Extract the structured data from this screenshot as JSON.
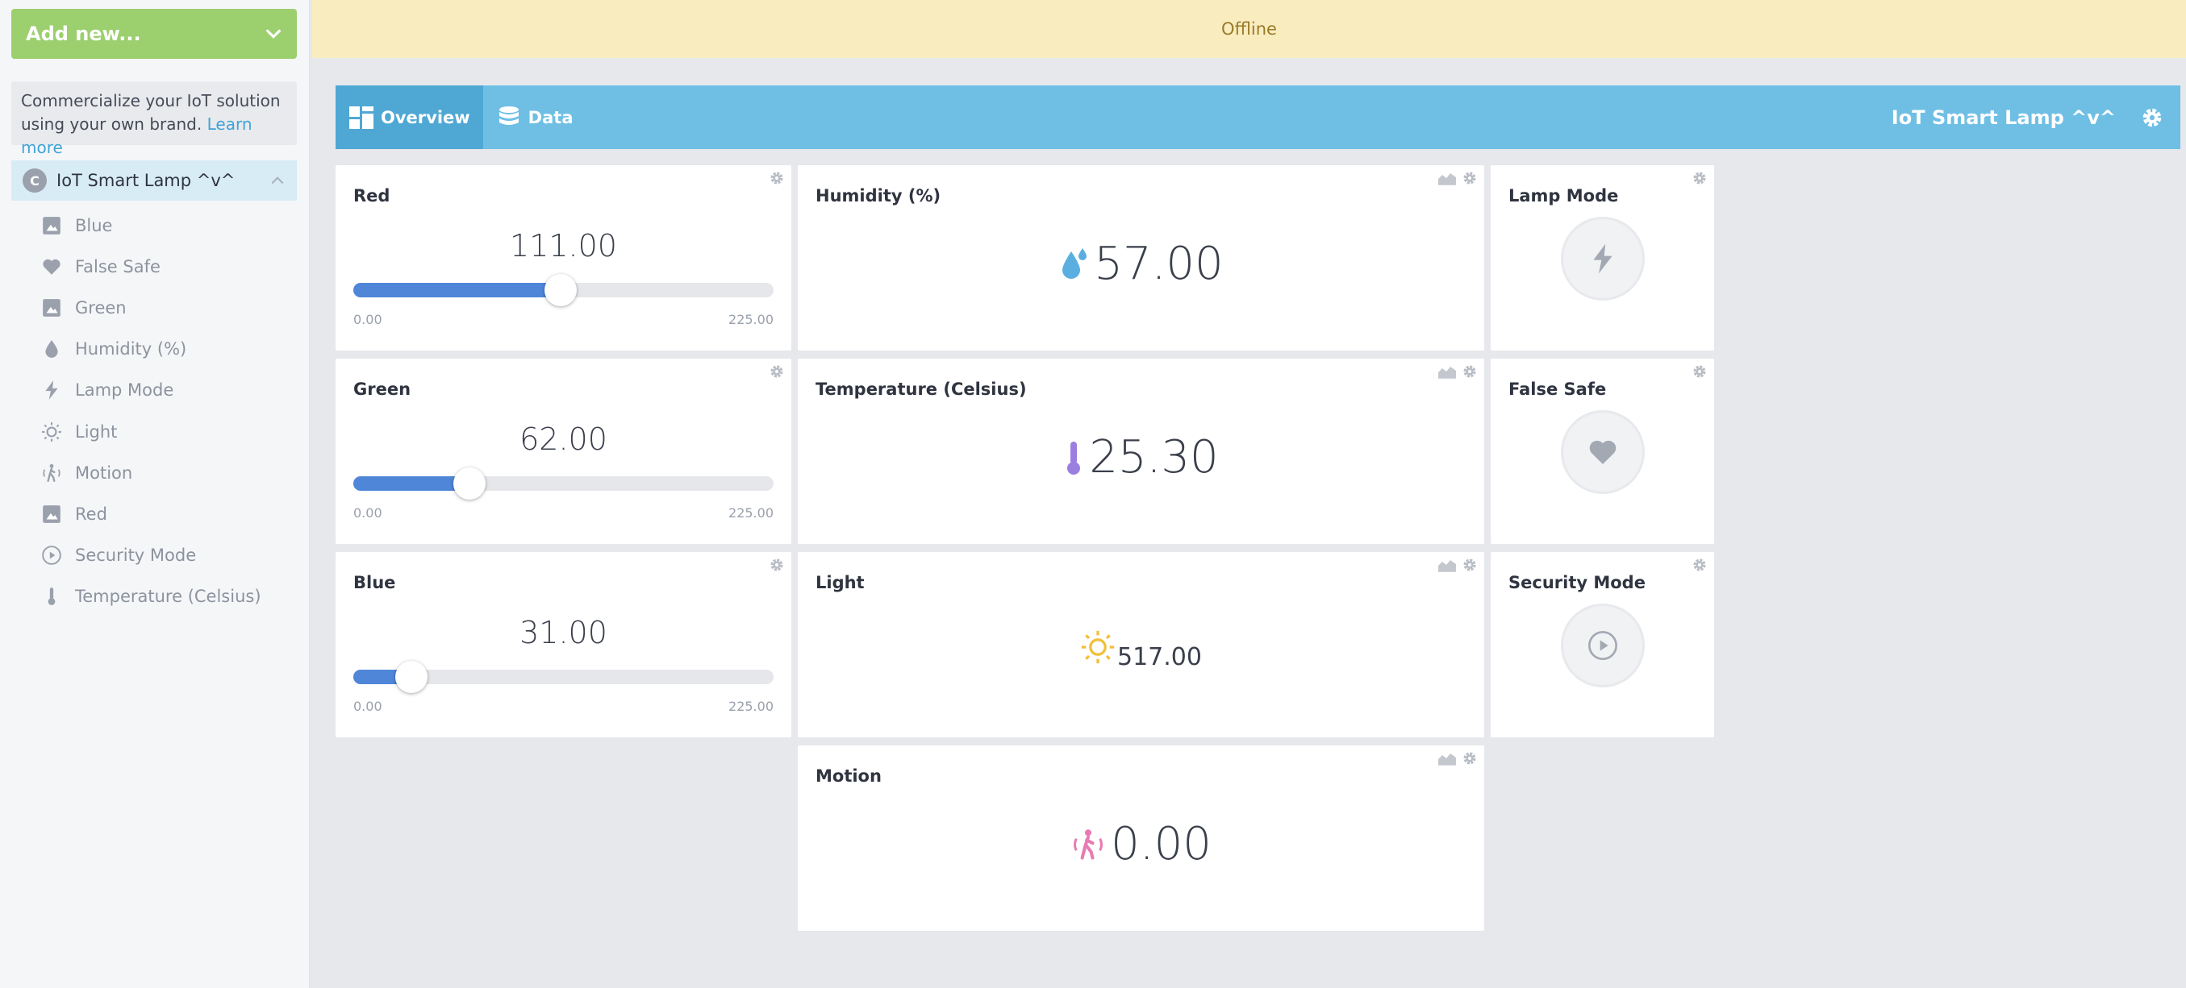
{
  "sidebar": {
    "add_new_label": "Add new...",
    "promo_text": "Commercialize your IoT solution using your own brand.",
    "promo_link": "Learn more",
    "device_name": "IoT Smart Lamp ^v^",
    "items": [
      {
        "label": "Blue",
        "icon": "image-icon"
      },
      {
        "label": "False Safe",
        "icon": "heart-icon"
      },
      {
        "label": "Green",
        "icon": "image-icon"
      },
      {
        "label": "Humidity (%)",
        "icon": "drop-icon"
      },
      {
        "label": "Lamp Mode",
        "icon": "bolt-icon"
      },
      {
        "label": "Light",
        "icon": "sun-icon"
      },
      {
        "label": "Motion",
        "icon": "motion-icon"
      },
      {
        "label": "Red",
        "icon": "image-icon"
      },
      {
        "label": "Security Mode",
        "icon": "play-icon"
      },
      {
        "label": "Temperature (Celsius)",
        "icon": "thermometer-icon"
      }
    ]
  },
  "status_bar": {
    "text": "Offline"
  },
  "header": {
    "tabs": [
      {
        "label": "Overview",
        "active": true
      },
      {
        "label": "Data",
        "active": false
      }
    ],
    "device_title": "IoT Smart Lamp ^v^"
  },
  "widgets": {
    "red": {
      "title": "Red",
      "value": "111.00",
      "min": "0.00",
      "max": "225.00",
      "fraction": 0.493
    },
    "green": {
      "title": "Green",
      "value": "62.00",
      "min": "0.00",
      "max": "225.00",
      "fraction": 0.276
    },
    "blue": {
      "title": "Blue",
      "value": "31.00",
      "min": "0.00",
      "max": "225.00",
      "fraction": 0.138
    },
    "humidity": {
      "title": "Humidity (%)",
      "value": "57.00"
    },
    "temperature": {
      "title": "Temperature (Celsius)",
      "value": "25.30"
    },
    "light": {
      "title": "Light",
      "value": "517.00"
    },
    "motion": {
      "title": "Motion",
      "value": "0.00"
    },
    "lamp_mode": {
      "title": "Lamp Mode"
    },
    "false_safe": {
      "title": "False Safe"
    },
    "security_mode": {
      "title": "Security Mode"
    }
  },
  "colors": {
    "add_new_bg": "#9ccf6e",
    "header_bg": "#6fbfe5",
    "slider_fill": "#4f86d8",
    "offline_bg": "#f9edc0",
    "humidity_icon": "#5aaee0",
    "temperature_icon": "#9b7fe0",
    "light_icon": "#f2bf3a",
    "motion_icon": "#e87ab3"
  }
}
